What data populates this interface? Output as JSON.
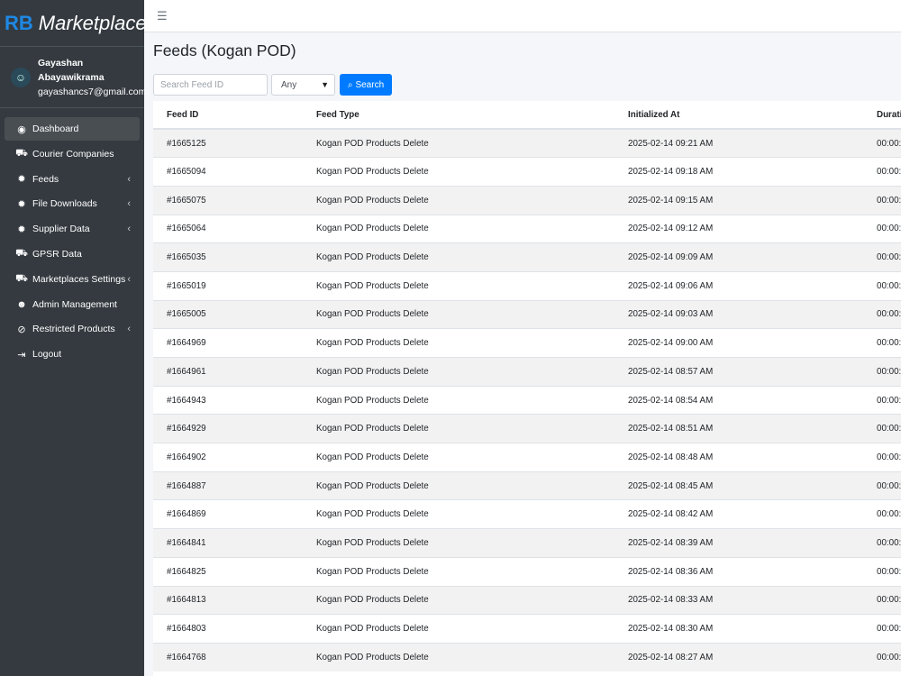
{
  "brand": {
    "short": "RB",
    "name": "Marketplaces"
  },
  "user": {
    "name": "Gayashan Abayawikrama",
    "email": "gayashancs7@gmail.com"
  },
  "sidebar": {
    "items": [
      {
        "label": "Dashboard",
        "icon": "dashboard-icon",
        "glyph": "◉",
        "active": true,
        "chevron": false
      },
      {
        "label": "Courier Companies",
        "icon": "truck-icon",
        "glyph": "⛟",
        "active": false,
        "chevron": false
      },
      {
        "label": "Feeds",
        "icon": "cog-icon",
        "glyph": "✹",
        "active": false,
        "chevron": true
      },
      {
        "label": "File Downloads",
        "icon": "cog-icon",
        "glyph": "✹",
        "active": false,
        "chevron": true
      },
      {
        "label": "Supplier Data",
        "icon": "cog-icon",
        "glyph": "✹",
        "active": false,
        "chevron": true
      },
      {
        "label": "GPSR Data",
        "icon": "truck-icon",
        "glyph": "⛟",
        "active": false,
        "chevron": false
      },
      {
        "label": "Marketplaces Settings",
        "icon": "truck-icon",
        "glyph": "⛟",
        "active": false,
        "chevron": true
      },
      {
        "label": "Admin Management",
        "icon": "user-cog-icon",
        "glyph": "☻",
        "active": false,
        "chevron": false
      },
      {
        "label": "Restricted Products",
        "icon": "ban-icon",
        "glyph": "⊘",
        "active": false,
        "chevron": true
      },
      {
        "label": "Logout",
        "icon": "logout-icon",
        "glyph": "⇥",
        "active": false,
        "chevron": false
      }
    ]
  },
  "page": {
    "title": "Feeds (Kogan POD)"
  },
  "filters": {
    "search_placeholder": "Search Feed ID",
    "select_value": "Any",
    "search_label": "Search"
  },
  "table": {
    "headers": [
      "Feed ID",
      "Feed Type",
      "Initialized At",
      "Duration"
    ],
    "rows": [
      [
        "#1665125",
        "Kogan POD Products Delete",
        "2025-02-14 09:21 AM",
        "00:00:"
      ],
      [
        "#1665094",
        "Kogan POD Products Delete",
        "2025-02-14 09:18 AM",
        "00:00:"
      ],
      [
        "#1665075",
        "Kogan POD Products Delete",
        "2025-02-14 09:15 AM",
        "00:00:"
      ],
      [
        "#1665064",
        "Kogan POD Products Delete",
        "2025-02-14 09:12 AM",
        "00:00:"
      ],
      [
        "#1665035",
        "Kogan POD Products Delete",
        "2025-02-14 09:09 AM",
        "00:00:"
      ],
      [
        "#1665019",
        "Kogan POD Products Delete",
        "2025-02-14 09:06 AM",
        "00:00:"
      ],
      [
        "#1665005",
        "Kogan POD Products Delete",
        "2025-02-14 09:03 AM",
        "00:00:"
      ],
      [
        "#1664969",
        "Kogan POD Products Delete",
        "2025-02-14 09:00 AM",
        "00:00:"
      ],
      [
        "#1664961",
        "Kogan POD Products Delete",
        "2025-02-14 08:57 AM",
        "00:00:"
      ],
      [
        "#1664943",
        "Kogan POD Products Delete",
        "2025-02-14 08:54 AM",
        "00:00:"
      ],
      [
        "#1664929",
        "Kogan POD Products Delete",
        "2025-02-14 08:51 AM",
        "00:00:"
      ],
      [
        "#1664902",
        "Kogan POD Products Delete",
        "2025-02-14 08:48 AM",
        "00:00:"
      ],
      [
        "#1664887",
        "Kogan POD Products Delete",
        "2025-02-14 08:45 AM",
        "00:00:"
      ],
      [
        "#1664869",
        "Kogan POD Products Delete",
        "2025-02-14 08:42 AM",
        "00:00:"
      ],
      [
        "#1664841",
        "Kogan POD Products Delete",
        "2025-02-14 08:39 AM",
        "00:00:"
      ],
      [
        "#1664825",
        "Kogan POD Products Delete",
        "2025-02-14 08:36 AM",
        "00:00:"
      ],
      [
        "#1664813",
        "Kogan POD Products Delete",
        "2025-02-14 08:33 AM",
        "00:00:"
      ],
      [
        "#1664803",
        "Kogan POD Products Delete",
        "2025-02-14 08:30 AM",
        "00:00:"
      ],
      [
        "#1664768",
        "Kogan POD Products Delete",
        "2025-02-14 08:27 AM",
        "00:00:"
      ]
    ]
  },
  "colors": {
    "sidebar_bg": "#343a40",
    "accent": "#007bff",
    "brand_rb": "#1e88e5"
  }
}
